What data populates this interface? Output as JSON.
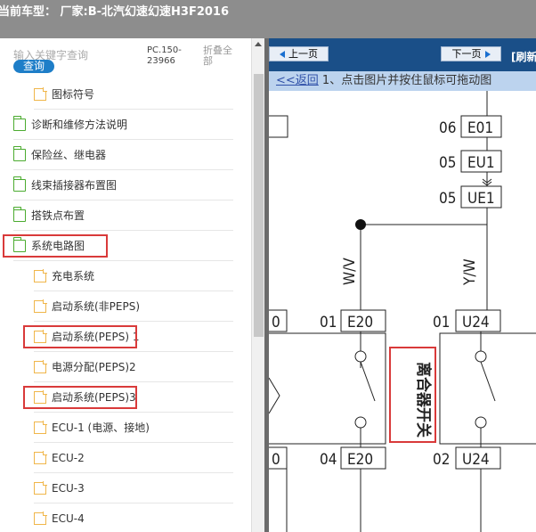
{
  "header": {
    "title": "当前车型： 厂家:B-北汽幻速幻速H3F2016"
  },
  "left": {
    "search_placeholder": "输入关键字查询",
    "search_button": "查询",
    "pc_code": "PC.150-23966",
    "fold_all": "折叠全部",
    "tree": [
      {
        "label": "图标符号",
        "type": "file",
        "indent": 1
      },
      {
        "label": "诊断和维修方法说明",
        "type": "folder",
        "indent": 0
      },
      {
        "label": "保险丝、继电器",
        "type": "folder",
        "indent": 0
      },
      {
        "label": "线束插接器布置图",
        "type": "folder",
        "indent": 0
      },
      {
        "label": "搭铁点布置",
        "type": "folder",
        "indent": 0
      },
      {
        "label": "系统电路图",
        "type": "folder",
        "indent": 0,
        "highlighted": true
      },
      {
        "label": "充电系统",
        "type": "file",
        "indent": 1
      },
      {
        "label": "启动系统(非PEPS)",
        "type": "file",
        "indent": 1
      },
      {
        "label": "启动系统(PEPS) 1",
        "type": "file",
        "indent": 1,
        "highlighted": true
      },
      {
        "label": "电源分配(PEPS)2",
        "type": "file",
        "indent": 1
      },
      {
        "label": "启动系统(PEPS)3",
        "type": "file",
        "indent": 1,
        "highlighted": true
      },
      {
        "label": "ECU-1 (电源、接地)",
        "type": "file",
        "indent": 1
      },
      {
        "label": "ECU-2",
        "type": "file",
        "indent": 1
      },
      {
        "label": "ECU-3",
        "type": "file",
        "indent": 1
      },
      {
        "label": "ECU-4",
        "type": "file",
        "indent": 1
      }
    ]
  },
  "right": {
    "prev_page": "上一页",
    "next_page": "下一页",
    "refresh": "[刷新",
    "back_link": "<<返回",
    "instruction": " 1、点击图片并按住鼠标可拖动图",
    "diagram": {
      "connectors_top": [
        {
          "pin": "06",
          "code": "E01"
        },
        {
          "pin": "05",
          "code": "EU1"
        },
        {
          "pin": "05",
          "code": "UE1"
        }
      ],
      "wire_left": "W/V",
      "wire_right": "Y/W",
      "switch_left_top": {
        "pin": "01",
        "code": "E20"
      },
      "switch_left_bottom": {
        "pin": "04",
        "code": "E20"
      },
      "switch_right_top": {
        "pin": "01",
        "code": "U24"
      },
      "switch_right_bottom": {
        "pin": "02",
        "code": "U24"
      },
      "partial_left_top": "0",
      "partial_left_bottom": "0",
      "switch_label": "离合器开关"
    }
  },
  "colors": {
    "nav_bg": "#1a4f88",
    "highlight": "#d93a3a",
    "folder": "#4bab2f",
    "file": "#f0b64a",
    "subbar": "#bcd3ee"
  }
}
